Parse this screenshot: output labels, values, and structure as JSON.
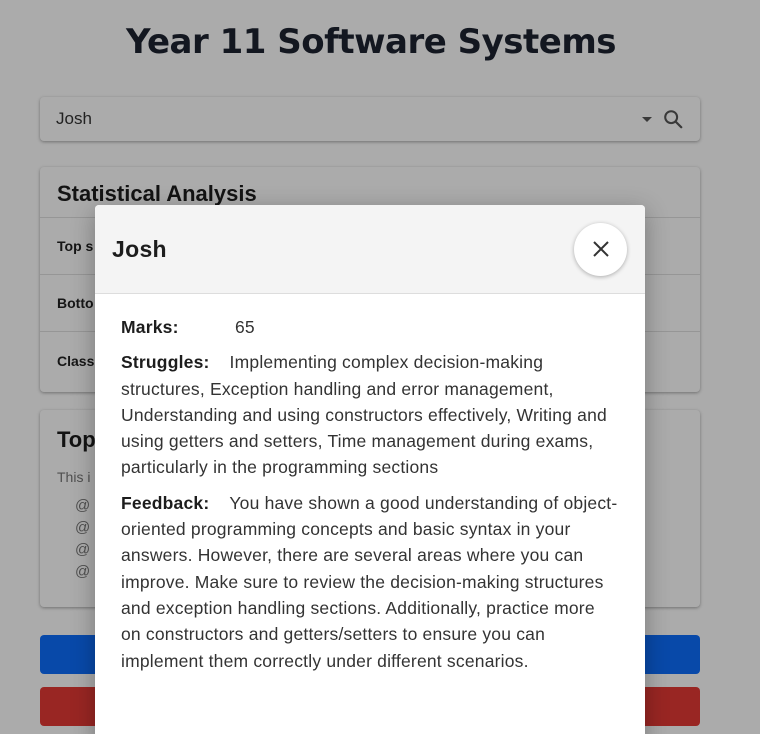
{
  "page": {
    "title": "Year 11 Software Systems"
  },
  "student_select": {
    "value": "Josh",
    "dropdown_icon": "caret-down-icon",
    "search_icon": "search-icon"
  },
  "stats_card": {
    "title": "Statistical Analysis",
    "rows": [
      "Top s",
      "Botto",
      "Class"
    ]
  },
  "top_card": {
    "title": "Top",
    "intro": "This i",
    "items": [
      "@",
      "@",
      "@",
      "@"
    ]
  },
  "colors": {
    "primary_button": "#0d6efd",
    "danger_button": "#e53935",
    "overlay": "rgba(0,0,0,0.33)"
  },
  "dialog": {
    "title": "Josh",
    "close_icon": "close-icon",
    "close_glyph": "✕",
    "marks_label": "Marks:",
    "marks_value": "65",
    "struggles_label": "Struggles:",
    "struggles_value": "Implementing complex decision-making structures, Exception handling and error management, Understanding and using constructors effectively, Writing and using getters and setters, Time management during exams, particularly in the programming sections",
    "feedback_label": "Feedback:",
    "feedback_value": "You have shown a good understanding of object-oriented programming concepts and basic syntax in your answers. However, there are several areas where you can improve. Make sure to review the decision-making structures and exception handling sections. Additionally, practice more on constructors and getters/setters to ensure you can implement them correctly under different scenarios."
  }
}
